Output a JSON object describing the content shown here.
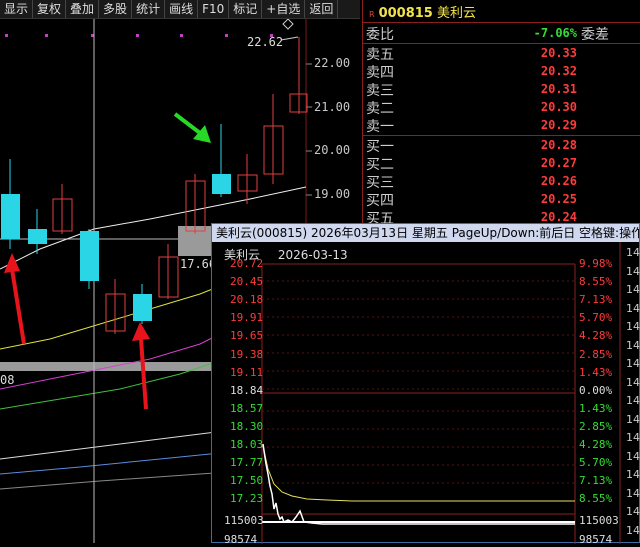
{
  "toolbar": {
    "items": [
      "显示",
      "复权",
      "叠加",
      "多股",
      "统计",
      "画线",
      "F10",
      "标记",
      "+自选",
      "返回"
    ]
  },
  "main_chart": {
    "price_ticks": [
      "22.00",
      "21.00",
      "20.00",
      "19.00"
    ],
    "high_label": "22.62",
    "ma_label": "17.66",
    "left_cut_label": "08"
  },
  "quote": {
    "r_mark": "R",
    "code": "000815",
    "name": "美利云",
    "ratio_label": "委比",
    "ratio_value": "-7.06%",
    "diff_label": "委差",
    "asks": [
      {
        "label": "卖五",
        "price": "20.33"
      },
      {
        "label": "卖四",
        "price": "20.32"
      },
      {
        "label": "卖三",
        "price": "20.31"
      },
      {
        "label": "卖二",
        "price": "20.30"
      },
      {
        "label": "卖一",
        "price": "20.29"
      }
    ],
    "bids": [
      {
        "label": "买一",
        "price": "20.28"
      },
      {
        "label": "买二",
        "price": "20.27"
      },
      {
        "label": "买三",
        "price": "20.26"
      },
      {
        "label": "买四",
        "price": "20.25"
      },
      {
        "label": "买五",
        "price": "20.24"
      }
    ]
  },
  "popup": {
    "title_bar": "美利云(000815) 2026年03月13日 星期五 PageUp/Down:前后日 空格键:操作",
    "stock_name": "美利云",
    "date": "2026-03-13",
    "left_ticks": [
      {
        "text": "20.72",
        "color": "#ff3b3b"
      },
      {
        "text": "20.45",
        "color": "#ff3b3b"
      },
      {
        "text": "20.18",
        "color": "#ff3b3b"
      },
      {
        "text": "19.91",
        "color": "#ff3b3b"
      },
      {
        "text": "19.65",
        "color": "#ff3b3b"
      },
      {
        "text": "19.38",
        "color": "#ff3b3b"
      },
      {
        "text": "19.11",
        "color": "#ff3b3b"
      },
      {
        "text": "18.84",
        "color": "#dddddd"
      },
      {
        "text": "18.57",
        "color": "#33dd33"
      },
      {
        "text": "18.30",
        "color": "#33dd33"
      },
      {
        "text": "18.03",
        "color": "#33dd33"
      },
      {
        "text": "17.77",
        "color": "#33dd33"
      },
      {
        "text": "17.50",
        "color": "#33dd33"
      },
      {
        "text": "17.23",
        "color": "#33dd33"
      }
    ],
    "right_ticks": [
      {
        "text": "9.98%",
        "color": "#ff3b3b"
      },
      {
        "text": "8.55%",
        "color": "#ff3b3b"
      },
      {
        "text": "7.13%",
        "color": "#ff3b3b"
      },
      {
        "text": "5.70%",
        "color": "#ff3b3b"
      },
      {
        "text": "4.28%",
        "color": "#ff3b3b"
      },
      {
        "text": "2.85%",
        "color": "#ff3b3b"
      },
      {
        "text": "1.43%",
        "color": "#ff3b3b"
      },
      {
        "text": "0.00%",
        "color": "#dddddd"
      },
      {
        "text": "1.43%",
        "color": "#33dd33"
      },
      {
        "text": "2.85%",
        "color": "#33dd33"
      },
      {
        "text": "4.28%",
        "color": "#33dd33"
      },
      {
        "text": "5.70%",
        "color": "#33dd33"
      },
      {
        "text": "7.13%",
        "color": "#33dd33"
      },
      {
        "text": "8.55%",
        "color": "#33dd33"
      }
    ],
    "volume_max": "115003",
    "volume_max_right": "115003",
    "volume_low": "98574",
    "volume_low_right": "98574",
    "side_numbers": [
      "14",
      "14",
      "14",
      "14",
      "14",
      "14",
      "14",
      "14",
      "14",
      "14",
      "14",
      "14",
      "14",
      "14",
      "14",
      "14"
    ]
  }
}
